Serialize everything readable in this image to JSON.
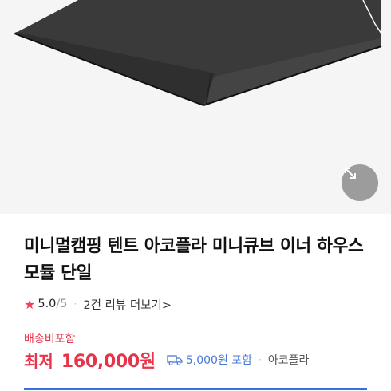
{
  "product": {
    "title": "미니멀캠핑 텐트 아코플라 미니큐브 이너 하우스모듈 단일"
  },
  "rating": {
    "icon": "star-icon",
    "score": "5.0",
    "max": "/5",
    "separator": "·",
    "review_link": "2건 리뷰 더보기>"
  },
  "shipping_note": "배송비포함",
  "price": {
    "prefix": "최저",
    "value": "160,000원",
    "shipping_fee": "5,000원 포함",
    "separator": "·",
    "seller": "아코플라"
  },
  "colors": {
    "price_red": "#e8334a",
    "star_red": "#f0425a",
    "shipping_blue": "#4a78d6",
    "underline_blue": "#3d6fd8",
    "image_background": "#f5f5f5"
  }
}
